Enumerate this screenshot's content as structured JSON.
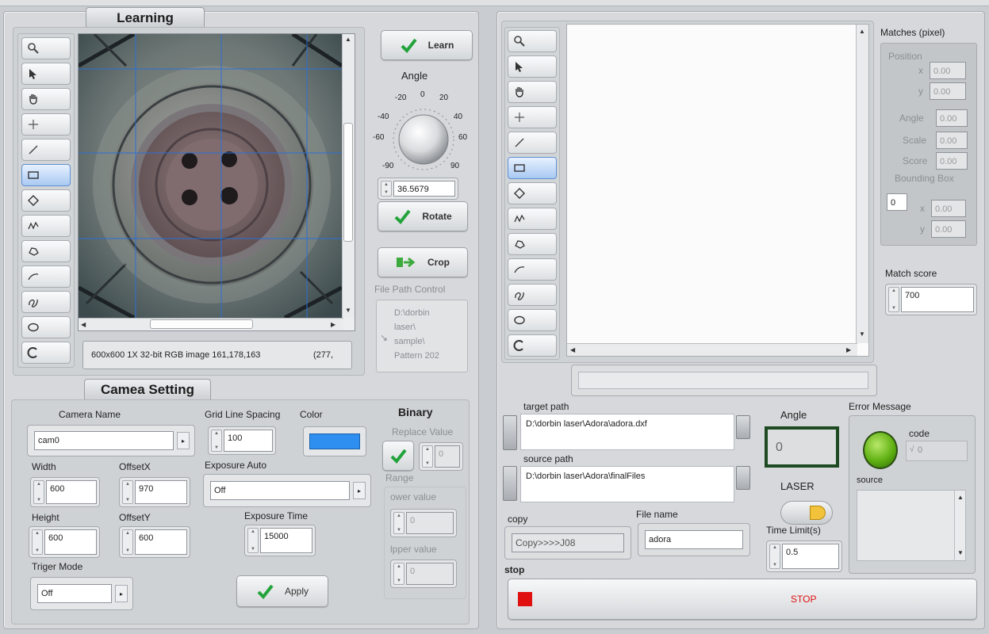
{
  "learning": {
    "title": "Learning",
    "image_info": "600x600 1X 32-bit RGB image 161,178,163",
    "coords": "(277,",
    "learn_label": "Learn",
    "angle_label": "Angle",
    "angle_ticks": [
      "-20",
      "0",
      "20",
      "-40",
      "40",
      "-60",
      "60",
      "-90",
      "90"
    ],
    "angle_value": "36.5679",
    "rotate_label": "Rotate",
    "crop_label": "Crop",
    "file_path_label": "File Path Control",
    "file_path_lines": [
      "D:\\dorbin",
      "laser\\",
      "sample\\",
      "Pattern 202"
    ]
  },
  "camera": {
    "title": "Camea Setting",
    "camera_name_label": "Camera Name",
    "camera_name_value": "cam0",
    "grid_spacing_label": "Grid Line Spacing",
    "grid_spacing_value": "100",
    "color_label": "Color",
    "color_value": "#2f8ff0",
    "width_label": "Width",
    "width_value": "600",
    "offsetx_label": "OffsetX",
    "offsetx_value": "970",
    "exposure_auto_label": "Exposure Auto",
    "exposure_auto_value": "Off",
    "height_label": "Height",
    "height_value": "600",
    "offsety_label": "OffsetY",
    "offsety_value": "600",
    "exposure_time_label": "Exposure Time",
    "exposure_time_value": "15000",
    "trigger_label": "Triger Mode",
    "trigger_value": "Off",
    "apply_label": "Apply",
    "binary_label": "Binary",
    "replace_label": "Replace Value",
    "replace_value": "0",
    "range_label": "Range",
    "lower_label": "ower value",
    "lower_value": "0",
    "upper_label": "lpper value",
    "upper_value": "0"
  },
  "matches": {
    "title": "Matches (pixel)",
    "position_label": "Position",
    "x_label": "x",
    "x_value": "0.00",
    "y_label": "y",
    "y_value": "0.00",
    "angle_label": "Angle",
    "angle_value": "0.00",
    "scale_label": "Scale",
    "scale_value": "0.00",
    "score_label": "Score",
    "score_value": "0.00",
    "bbox_label": "Bounding Box",
    "bbox_index": "0",
    "bbox_x": "0.00",
    "bbox_y": "0.00",
    "match_score_label": "Match score",
    "match_score_value": "700"
  },
  "paths": {
    "target_label": "target path",
    "target_value": "D:\\dorbin laser\\Adora\\adora.dxf",
    "source_label": "source path",
    "source_value": "D:\\dorbin laser\\Adora\\finalFiles",
    "angle_label": "Angle",
    "angle_value": "0",
    "laser_label": "LASER",
    "copy_label": "copy",
    "copy_value": "Copy>>>>J08",
    "file_name_label": "File name",
    "file_name_value": "adora",
    "time_limit_label": "Time Limit(s)",
    "time_limit_value": "0.5",
    "stop_label": "stop",
    "stop_button": "STOP"
  },
  "error": {
    "title": "Error Message",
    "code_label": "code",
    "code_value": "0",
    "source_label": "source"
  },
  "colors": {
    "accent_blue": "#2f8ff0",
    "stop_red": "#e01010",
    "led_green": "#5fb012",
    "angle_border": "#1e4a22",
    "check_green": "#22a33a"
  },
  "icons": [
    "zoom-icon",
    "pointer-icon",
    "pan-icon",
    "crosshair-icon",
    "line-icon",
    "rectangle-icon",
    "rotated-rectangle-icon",
    "freeline-icon",
    "polygon-icon",
    "polyline-icon",
    "freehand-icon",
    "oval-icon",
    "annulus-icon"
  ]
}
